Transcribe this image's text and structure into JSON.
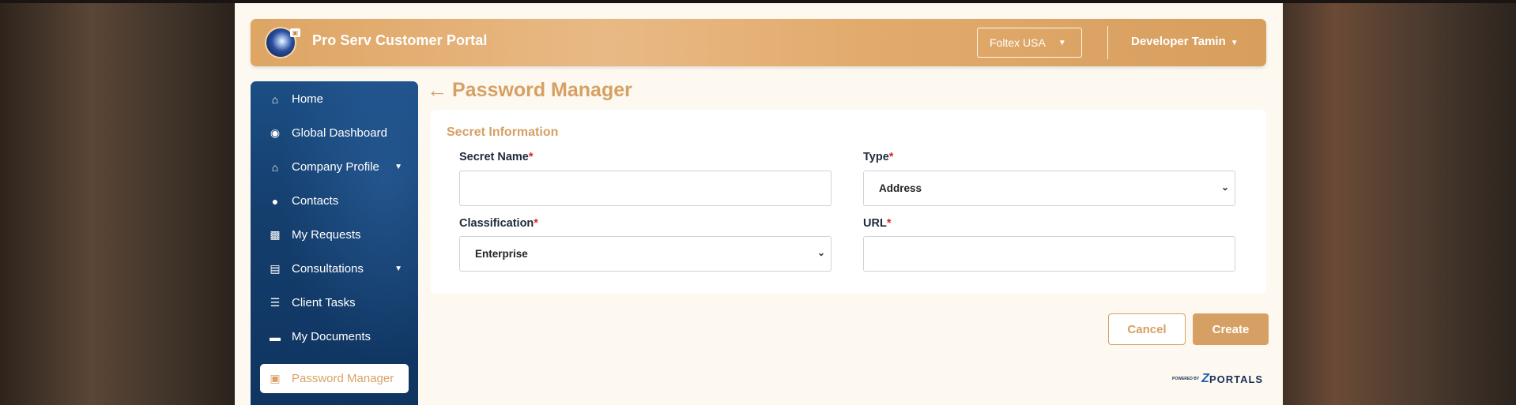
{
  "header": {
    "portal_title": "Pro Serv Customer Portal",
    "company": "Foltex USA",
    "user": "Developer Tamin"
  },
  "sidebar": {
    "items": [
      {
        "label": "Home",
        "icon": "home-icon"
      },
      {
        "label": "Global Dashboard",
        "icon": "globe-icon"
      },
      {
        "label": "Company Profile",
        "icon": "house-icon",
        "has_submenu": true
      },
      {
        "label": "Contacts",
        "icon": "person-icon"
      },
      {
        "label": "My Requests",
        "icon": "inbox-icon"
      },
      {
        "label": "Consultations",
        "icon": "server-icon",
        "has_submenu": true
      },
      {
        "label": "Client Tasks",
        "icon": "checklist-icon"
      },
      {
        "label": "My Documents",
        "icon": "folder-icon"
      },
      {
        "label": "Password Manager",
        "icon": "lock-icon",
        "active": true
      }
    ]
  },
  "page": {
    "title": "Password Manager"
  },
  "form": {
    "section_title": "Secret Information",
    "secret_name_label": "Secret Name",
    "secret_name_value": "",
    "type_label": "Type",
    "type_value": "Address",
    "classification_label": "Classification",
    "classification_value": "Enterprise",
    "url_label": "URL",
    "url_value": "",
    "required_mark": "*"
  },
  "actions": {
    "cancel_label": "Cancel",
    "create_label": "Create"
  },
  "footer": {
    "powered_by": "POWERED BY",
    "brand": "PORTALS"
  },
  "colors": {
    "accent": "#d6a064",
    "sidebar": "#143e6d",
    "required": "#dd2222"
  }
}
